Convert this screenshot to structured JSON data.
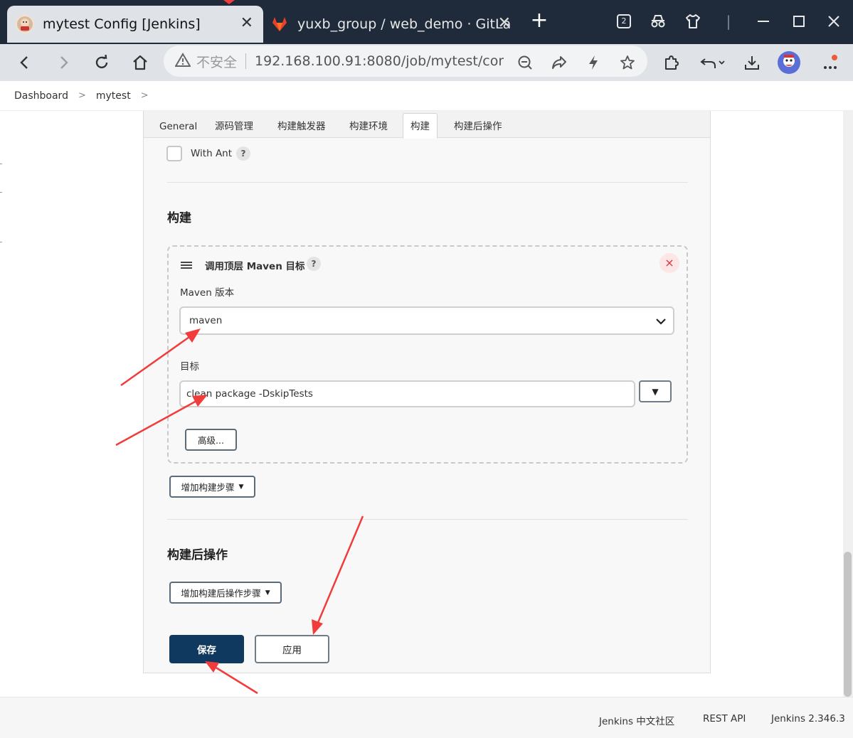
{
  "browser": {
    "tabs": [
      {
        "title": "mytest Config [Jenkins]",
        "icon": "jenkins-icon",
        "active": true
      },
      {
        "title": "yuxb_group / web_demo · GitLab",
        "icon": "gitlab-icon",
        "active": false
      }
    ],
    "new_tab_symbol": "+",
    "close_symbol": "✕",
    "tab_count_badge": "2",
    "omnibox": {
      "security_label": "不安全",
      "url": "192.168.100.91:8080/job/mytest/confi..."
    }
  },
  "breadcrumb": {
    "items": [
      "Dashboard",
      "mytest"
    ],
    "separator": ">"
  },
  "config_tabs": [
    "General",
    "源码管理",
    "构建触发器",
    "构建环境",
    "构建",
    "构建后操作"
  ],
  "active_tab_index": 4,
  "with_ant": {
    "label": "With Ant",
    "checked": false,
    "help": "?"
  },
  "build_section": {
    "title": "构建",
    "step": {
      "title": "调用顶层 Maven 目标",
      "help": "?",
      "maven_version_label": "Maven 版本",
      "maven_version_value": "maven",
      "goals_label": "目标",
      "goals_value": "clean package -DskipTests",
      "expand_symbol": "▼",
      "advanced_label": "高级...",
      "remove_symbol": "×"
    },
    "add_step_label": "增加构建步骤"
  },
  "post_build_section": {
    "title": "构建后操作",
    "add_step_label": "增加构建后操作步骤"
  },
  "actions": {
    "save_label": "保存",
    "apply_label": "应用"
  },
  "footer": {
    "community": "Jenkins 中文社区",
    "rest_api": "REST API",
    "version": "Jenkins 2.346.3"
  },
  "colors": {
    "primary_button": "#10395f",
    "annotation_arrow": "#f23c3c",
    "tabbar": "#1f2a3a",
    "remove_badge_bg": "#fde6e6"
  }
}
